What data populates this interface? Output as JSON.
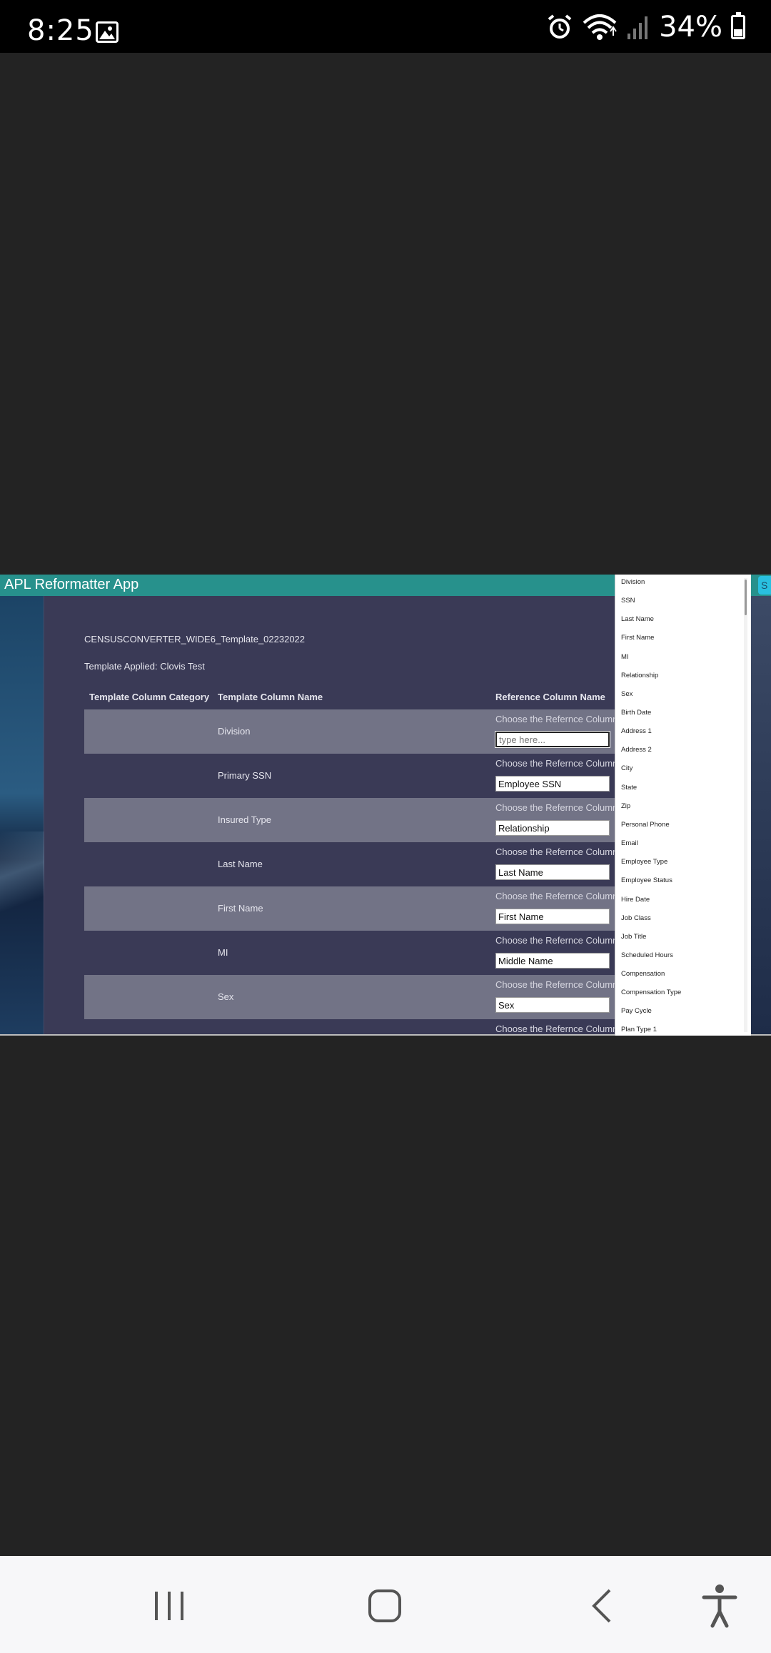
{
  "status_bar": {
    "time": "8:25",
    "battery_percent": "34%",
    "battery_level": 0.34,
    "icons": [
      "gallery-icon",
      "alarm-icon",
      "wifi-icon",
      "signal-icon",
      "battery-icon"
    ]
  },
  "app": {
    "title": "APL Reformatter App",
    "template_name": "CENSUSCONVERTER_WIDE6_Template_02232022",
    "template_applied": "Template Applied: Clovis Test",
    "right_tab_label": "S",
    "table": {
      "headers": [
        "Template Column Category",
        "Template Column Name",
        "Reference Column Name"
      ],
      "rows": [
        {
          "category": "",
          "name": "Division",
          "hint": "Choose the Refernce Column",
          "value": "",
          "placeholder": "type here..."
        },
        {
          "category": "",
          "name": "Primary SSN",
          "hint": "Choose the Refernce Column",
          "value": "Employee SSN",
          "placeholder": ""
        },
        {
          "category": "",
          "name": "Insured Type",
          "hint": "Choose the Refernce Column",
          "value": "Relationship",
          "placeholder": ""
        },
        {
          "category": "",
          "name": "Last Name",
          "hint": "Choose the Refernce Column",
          "value": "Last Name",
          "placeholder": ""
        },
        {
          "category": "",
          "name": "First Name",
          "hint": "Choose the Refernce Column",
          "value": "First Name",
          "placeholder": ""
        },
        {
          "category": "",
          "name": "MI",
          "hint": "Choose the Refernce Column",
          "value": "Middle Name",
          "placeholder": ""
        },
        {
          "category": "",
          "name": "Sex",
          "hint": "Choose the Refernce Column",
          "value": "Sex",
          "placeholder": ""
        },
        {
          "category": "",
          "name": "",
          "hint": "Choose the Refernce Column",
          "value": "",
          "placeholder": ""
        }
      ]
    }
  },
  "dropdown": {
    "options": [
      "Division",
      "SSN",
      "Last Name",
      "First Name",
      "MI",
      "Relationship",
      "Sex",
      "Birth Date",
      "Address 1",
      "Address 2",
      "City",
      "State",
      "Zip",
      "Personal Phone",
      "Email",
      "Employee Type",
      "Employee Status",
      "Hire Date",
      "Job Class",
      "Job Title",
      "Scheduled Hours",
      "Compensation",
      "Compensation Type",
      "Pay Cycle",
      "Plan Type 1"
    ]
  },
  "nav_bar": {
    "buttons": [
      "recent-apps-icon",
      "home-icon",
      "back-icon",
      "accessibility-icon"
    ]
  }
}
